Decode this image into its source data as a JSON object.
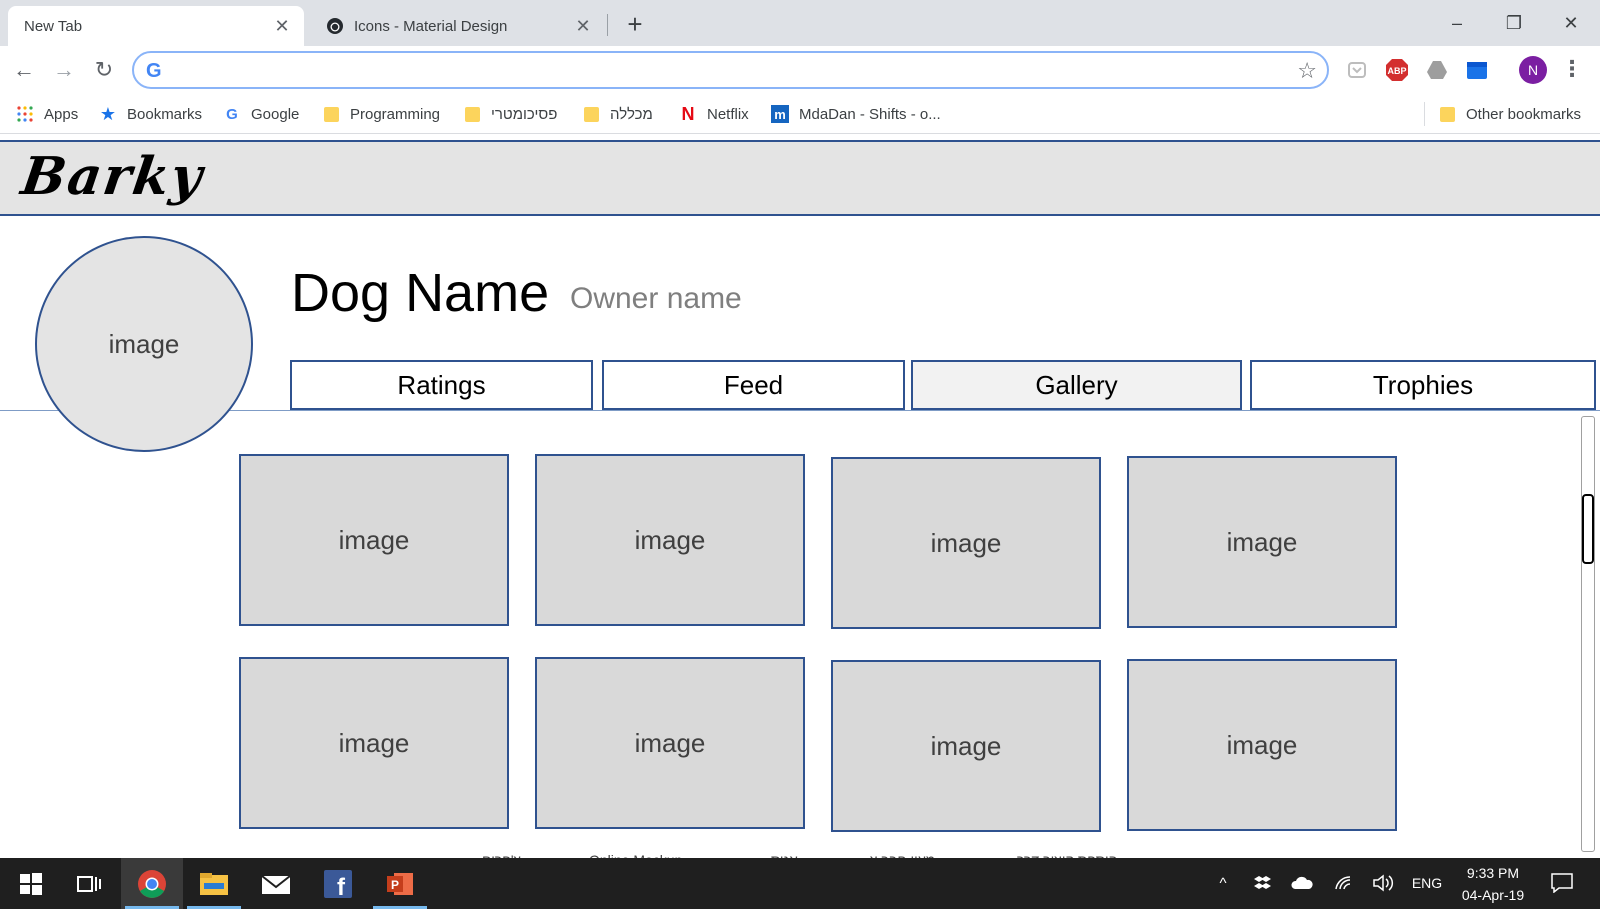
{
  "browser": {
    "tabs": [
      {
        "title": "New Tab",
        "active": true
      },
      {
        "title": "Icons - Material Design",
        "active": false
      }
    ],
    "new_tab_symbol": "+",
    "window_controls": {
      "minimize": "–",
      "restore": "❐",
      "close": "✕"
    },
    "omnibox": {
      "value": "",
      "placeholder": "",
      "engine_letter": "G"
    },
    "extensions": [
      "pocket-icon",
      "adblock-icon",
      "drive-icon",
      "calendar-icon"
    ],
    "profile_initial": "N",
    "bookmarks": [
      {
        "label": "Apps",
        "icon": "apps-grid-icon"
      },
      {
        "label": "Bookmarks",
        "icon": "star-icon"
      },
      {
        "label": "Google",
        "icon": "google-icon"
      },
      {
        "label": "Programming",
        "icon": "folder-icon"
      },
      {
        "label": "פסיכומטרי",
        "icon": "folder-icon"
      },
      {
        "label": "מכללה",
        "icon": "folder-icon"
      },
      {
        "label": "Netflix",
        "icon": "netflix-icon"
      },
      {
        "label": "MdaDan - Shifts - o...",
        "icon": "mdadan-icon"
      }
    ],
    "other_bookmarks": "Other bookmarks"
  },
  "mockup": {
    "brand": "Barky",
    "profile_image_label": "image",
    "dog_name": "Dog Name",
    "owner_name": "Owner name",
    "tabs": [
      {
        "label": "Ratings",
        "selected": false
      },
      {
        "label": "Feed",
        "selected": false
      },
      {
        "label": "Gallery",
        "selected": true
      },
      {
        "label": "Trophies",
        "selected": false
      }
    ],
    "gallery": [
      "image",
      "image",
      "image",
      "image",
      "image",
      "image",
      "image",
      "image"
    ],
    "ghost_footer": [
      "צ'פרים",
      "Online Mockup...",
      "אניס",
      "מעון חבר צ...",
      "הוספת קיצור דרך"
    ]
  },
  "taskbar": {
    "apps": [
      "windows-start-icon",
      "task-view-icon",
      "chrome-icon",
      "file-explorer-icon",
      "mail-icon",
      "facebook-icon",
      "powerpoint-icon"
    ],
    "language": "ENG",
    "time": "9:33 PM",
    "date": "04-Apr-19"
  },
  "colors": {
    "mockup_border": "#2f528f",
    "placeholder_fill": "#d9d9d9",
    "brand_bar": "#e4e4e4",
    "taskbar": "#1f1f1f"
  }
}
